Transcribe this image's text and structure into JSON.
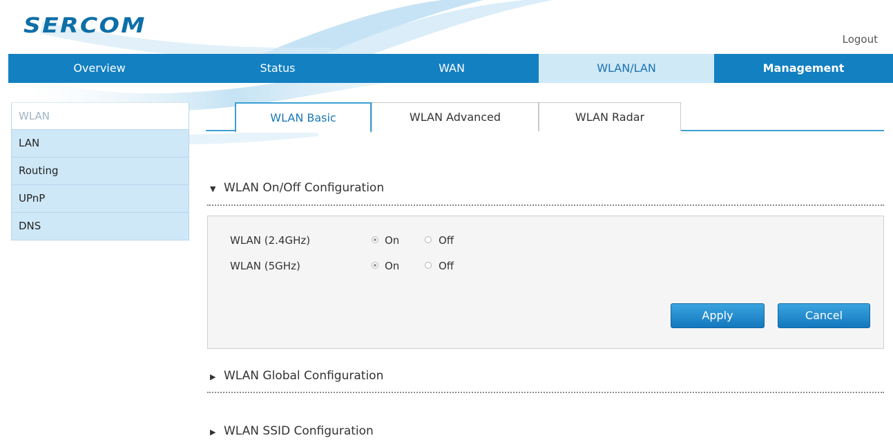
{
  "brand": {
    "logo_text": "SERCOM"
  },
  "header": {
    "logout_label": "Logout"
  },
  "topnav": {
    "items": [
      {
        "label": "Overview"
      },
      {
        "label": "Status"
      },
      {
        "label": "WAN"
      },
      {
        "label": "WLAN/LAN",
        "active": true
      },
      {
        "label": "Management"
      }
    ]
  },
  "sidebar": {
    "items": [
      {
        "label": "WLAN",
        "active": true
      },
      {
        "label": "LAN"
      },
      {
        "label": "Routing"
      },
      {
        "label": "UPnP"
      },
      {
        "label": "DNS"
      }
    ]
  },
  "subtabs": [
    {
      "label": "WLAN Basic",
      "active": true
    },
    {
      "label": "WLAN Advanced"
    },
    {
      "label": "WLAN Radar"
    }
  ],
  "sections": {
    "onoff": {
      "title": "WLAN On/Off Configuration",
      "expanded": true
    },
    "global": {
      "title": "WLAN Global Configuration",
      "expanded": false
    },
    "ssid": {
      "title": "WLAN SSID Configuration",
      "expanded": false
    }
  },
  "onoff_form": {
    "rows": [
      {
        "label": "WLAN (2.4GHz)",
        "on_label": "On",
        "off_label": "Off",
        "value": "On"
      },
      {
        "label": "WLAN (5GHz)",
        "on_label": "On",
        "off_label": "Off",
        "value": "On"
      }
    ],
    "apply_label": "Apply",
    "cancel_label": "Cancel"
  },
  "colors": {
    "nav_bg": "#1380c1",
    "nav_active_bg": "#cfe9f7",
    "tab_accent": "#3a9fd4",
    "sidebar_bg": "#cfe8f8",
    "button": "#1b86c9"
  },
  "icons": {
    "expanded": "triangle-down-icon",
    "collapsed": "triangle-right-icon"
  }
}
